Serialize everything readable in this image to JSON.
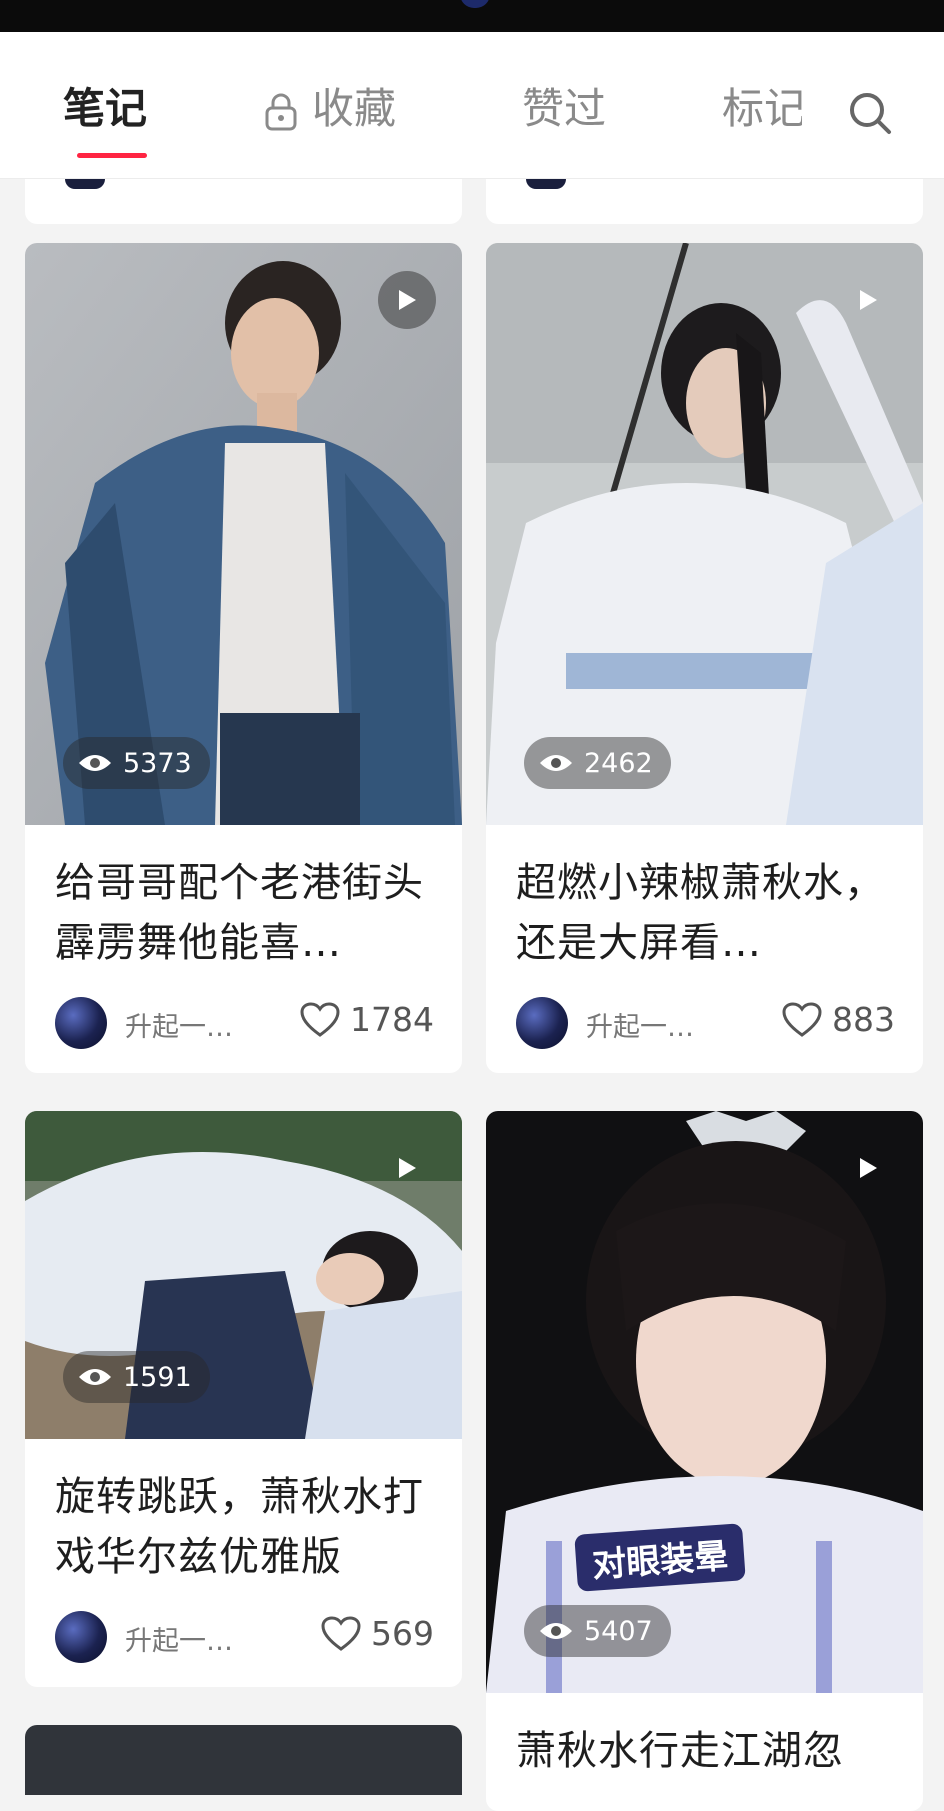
{
  "tabs": [
    {
      "label": "笔记",
      "active": true
    },
    {
      "label": "收藏",
      "locked": true
    },
    {
      "label": "赞过"
    },
    {
      "label": "标记"
    }
  ],
  "cards": [
    {
      "views": "5373",
      "title": "给哥哥配个老港街头霹雳舞他能喜…",
      "author": "升起一…",
      "likes": "1784"
    },
    {
      "views": "2462",
      "title": "超燃小辣椒萧秋水，还是大屏看…",
      "author": "升起一…",
      "likes": "883"
    },
    {
      "views": "1591",
      "title": "旋转跳跃，萧秋水打戏华尔兹优雅版",
      "author": "升起一…",
      "likes": "569"
    },
    {
      "views": "5407",
      "title": "萧秋水行走江湖忽",
      "sticker": "对眼装晕"
    }
  ],
  "colors": {
    "accent": "#ff2442",
    "statusbar": "#0b0b0b"
  },
  "icons": [
    "lock-icon",
    "search-icon",
    "play-icon",
    "eye-icon",
    "heart-icon"
  ]
}
